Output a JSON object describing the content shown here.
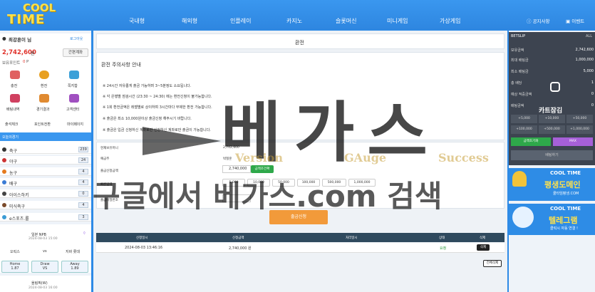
{
  "logo": {
    "line1": "COOL",
    "line2": "TIME"
  },
  "nav": [
    "국내형",
    "해외형",
    "인플레이",
    "카지노",
    "슬롯머신",
    "미니게임",
    "가상게임"
  ],
  "top_links": {
    "notice": "공지사항",
    "event": "이벤트"
  },
  "user": {
    "name": "최강훈이 님",
    "logout": "로그아웃",
    "money": "2,742,600",
    "money_unit": "원",
    "simple": "간편계좌",
    "points_label": "보유포인트",
    "points": "0",
    "points_unit": "P"
  },
  "quick": [
    {
      "label": "충전",
      "color": "#e06060"
    },
    {
      "label": "환전",
      "color": "#e8a020"
    },
    {
      "label": "쪽지함",
      "color": "#3ba0d8"
    },
    {
      "label": "배팅내역",
      "color": "#d04060"
    },
    {
      "label": "경기결과",
      "color": "#e08a30"
    },
    {
      "label": "고객센터",
      "color": "#a050c0"
    }
  ],
  "subbtns": [
    "출석체크",
    "포인트전환",
    "마이페이지"
  ],
  "sports_title": "오늘의경기",
  "sports": [
    {
      "name": "축구",
      "count": "239",
      "color": "#333"
    },
    {
      "name": "야구",
      "count": "24",
      "color": "#c33"
    },
    {
      "name": "농구",
      "count": "4",
      "color": "#e57a1e"
    },
    {
      "name": "배구",
      "count": "4",
      "color": "#3a7bd5"
    },
    {
      "name": "아이스하키",
      "count": "0",
      "color": "#444"
    },
    {
      "name": "미식축구",
      "count": "4",
      "color": "#7a4a2a"
    },
    {
      "name": "e스포츠.롤",
      "count": "3",
      "color": "#3a9bd5"
    }
  ],
  "match": {
    "league": "일본 NPB",
    "time": "2024-08-03 15:00",
    "home": "오릭스",
    "vs": "vs",
    "away": "지바 롯데",
    "odds": [
      {
        "label": "Home",
        "value": "1.87"
      },
      {
        "label": "Draw",
        "value": "VS"
      },
      {
        "label": "Away",
        "value": "1.89"
      }
    ],
    "next_league": "올림픽(W)",
    "next_time": "2024-08-03 16:00"
  },
  "page_title": "환전",
  "notice": {
    "title": "환전 주의사항 안내",
    "lines": [
      "※ 24시간 자유롭게 출금 가능하며 3~5분정도 소요됩니다.",
      "※ 각 은행별 점검시간 (23:30 ~ 24:30) 에는 환전신청이 불가능합니다.",
      "※ 1회 환전금액은 레벨별로 상이하며 3시간마다 무제한 환전 가능합니다.",
      "※ 출금은 최소 10,000원이상 출금신청 해주시기 바랍니다.",
      "※ 출금은 입금 신청하신 계좌로만 신청하신 계좌로만 출금이 가능합니다."
    ]
  },
  "form": {
    "rows": [
      {
        "label": "현재보유머니",
        "value": "2,742,600"
      },
      {
        "label": "예금주",
        "value": "박철훈"
      },
      {
        "label": "출금신청금액",
        "value": "2,740,000"
      },
      {
        "label": "빠른입력",
        "value": ""
      },
      {
        "label": "출금비밀번호",
        "value": ""
      }
    ],
    "ok_label": "금액조건확",
    "quick": [
      "5,000",
      "10,000",
      "50,000",
      "100,000",
      "500,000",
      "1,000,000"
    ]
  },
  "submit": "출금신청",
  "table": {
    "headers": [
      "신청일시",
      "신청금액",
      "처리일시",
      "상태",
      "삭제"
    ],
    "rows": [
      {
        "date": "2024-08-03 13:46:16",
        "amount": "2,740,000 원",
        "proc": "",
        "status": "요청",
        "del": "삭제"
      }
    ],
    "del_all": "전체삭제"
  },
  "bet": {
    "title": "BETSLIP",
    "all": "ALL",
    "rows": [
      {
        "label": "보유금액",
        "value": "2,742,600"
      },
      {
        "label": "최대 배팅금",
        "value": "1,000,000"
      },
      {
        "label": "최소 배팅금",
        "value": "5,000"
      },
      {
        "label": "총 배당",
        "value": "1"
      },
      {
        "label": "예상 적중금액",
        "value": "0"
      },
      {
        "label": "배팅금액",
        "value": "0"
      }
    ],
    "amounts": [
      "+5,000",
      "+10,000",
      "+50,000",
      "+100,000",
      "+500,000",
      "+1,000,000"
    ],
    "reset": "금액초기화",
    "max": "MAX",
    "bet_btn": "베팅하기",
    "lock": "카트잠김"
  },
  "banners": [
    {
      "title": "COOL TIME",
      "main": "평생도메인",
      "sub": "쿨타임평생.COM"
    },
    {
      "title": "COOL TIME",
      "main": "텔레그램",
      "sub": "클릭시 자동 연결 !"
    }
  ],
  "watermark": {
    "main": "베가스",
    "sub": [
      "Version",
      "GAuge",
      "Success"
    ],
    "search": "구글에서 베가스.com 검색"
  }
}
